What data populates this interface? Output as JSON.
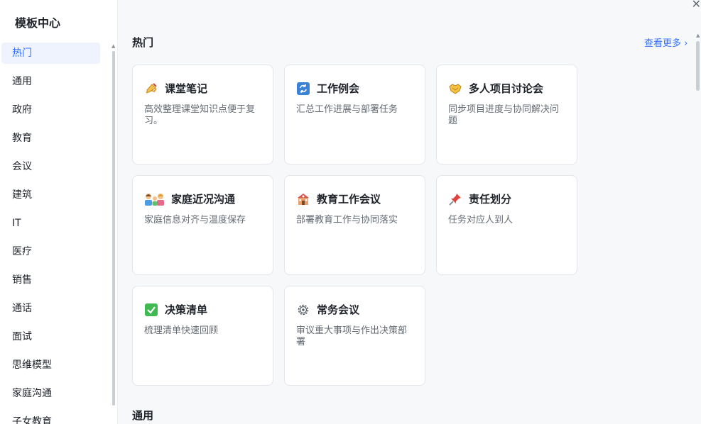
{
  "sidebar": {
    "title": "模板中心",
    "items": [
      {
        "label": "热门",
        "active": true
      },
      {
        "label": "通用"
      },
      {
        "label": "政府"
      },
      {
        "label": "教育"
      },
      {
        "label": "会议"
      },
      {
        "label": "建筑"
      },
      {
        "label": "IT"
      },
      {
        "label": "医疗"
      },
      {
        "label": "销售"
      },
      {
        "label": "通话"
      },
      {
        "label": "面试"
      },
      {
        "label": "思维模型"
      },
      {
        "label": "家庭沟通"
      },
      {
        "label": "子女教育"
      }
    ]
  },
  "main": {
    "hot_title": "热门",
    "more_label": "查看更多 ›",
    "next_section_title": "通用",
    "cards": [
      {
        "title": "课堂笔记",
        "desc": "高效整理课堂知识点便于复习。",
        "icon": "writing-hand-icon"
      },
      {
        "title": "工作例会",
        "desc": "汇总工作进展与部署任务",
        "icon": "repeat-icon"
      },
      {
        "title": "多人项目讨论会",
        "desc": "同步项目进度与协同解决问题",
        "icon": "handshake-icon"
      },
      {
        "title": "家庭近况沟通",
        "desc": "家庭信息对齐与温度保存",
        "icon": "family-icon"
      },
      {
        "title": "教育工作会议",
        "desc": "部署教育工作与协同落实",
        "icon": "school-icon"
      },
      {
        "title": "责任划分",
        "desc": "任务对应人到人",
        "icon": "pushpin-icon"
      },
      {
        "title": "决策清单",
        "desc": "梳理清单快速回顾",
        "icon": "check-box-icon"
      },
      {
        "title": "常务会议",
        "desc": "审议重大事项与作出决策部署",
        "icon": "gear-icon"
      }
    ]
  },
  "colors": {
    "accent": "#3370ff",
    "active_bg": "#eef3fd"
  }
}
